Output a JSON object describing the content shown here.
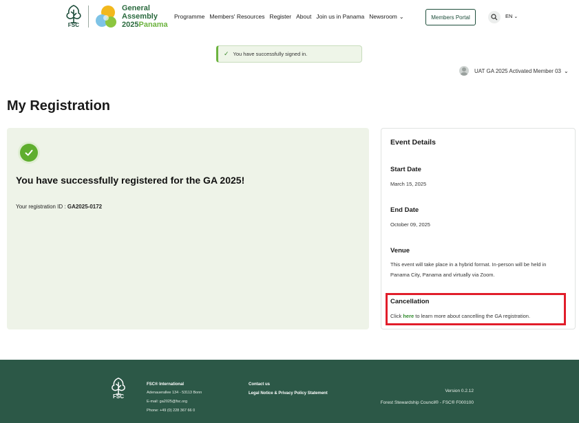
{
  "brand": {
    "fsc_label": "FSC",
    "ga_line1": "General",
    "ga_line2": "Assembly",
    "ga_year": "2025",
    "ga_place": "Panama",
    "colors": {
      "primary": "#1d4d3a",
      "accent": "#6cb33f",
      "footer": "#2c5847",
      "highlight": "#e11d2a"
    }
  },
  "nav": {
    "items": [
      "Programme",
      "Members' Resources",
      "Register",
      "About",
      "Join us in Panama",
      "Newsroom"
    ],
    "portal_label": "Members Portal",
    "lang": "EN"
  },
  "alert": {
    "message": "You have successfully signed in."
  },
  "user": {
    "name": "UAT GA 2025 Activated Member 03"
  },
  "page": {
    "title": "My Registration"
  },
  "success": {
    "heading": "You have successfully registered for the GA 2025!",
    "reg_label": "Your registration ID : ",
    "reg_id": "GA2025-0172"
  },
  "event": {
    "title": "Event Details",
    "start_label": "Start Date",
    "start_value": "March 15, 2025",
    "end_label": "End Date",
    "end_value": "October 09, 2025",
    "venue_label": "Venue",
    "venue_value": "This event will take place in a hybrid format. In-person will be held in Panama City, Panama and virtually via Zoom.",
    "cancel_label": "Cancellation",
    "cancel_pre": "Click ",
    "cancel_link": "here",
    "cancel_post": " to learn more about cancelling the GA registration."
  },
  "footer": {
    "fsc_label": "FSC",
    "org_name": "FSC® International",
    "address": "Adenauerallee 134 - 53113 Bonn",
    "email": "E-mail: ga2025@fsc.org",
    "phone": "Phone: +49 (0) 228 367 66 0",
    "contact": "Contact us",
    "legal": "Legal Notice & Privacy Policy Statement",
    "version": "Version 0.2.12",
    "copyright": "Forest Stewardship Council® - FSC® F000100"
  }
}
